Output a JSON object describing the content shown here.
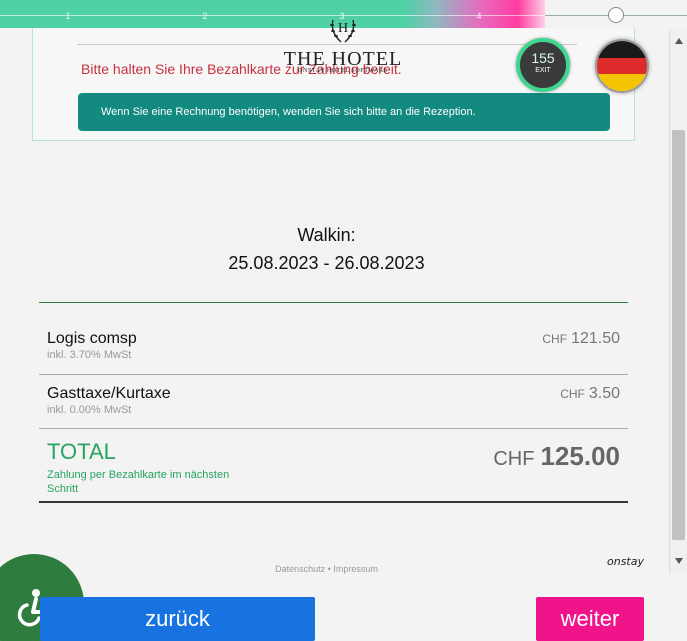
{
  "progress": {
    "steps": [
      "1",
      "2",
      "3",
      "4"
    ],
    "colors": {
      "fill_start": "#4fd1a5",
      "fill_end": "#ff3da0"
    }
  },
  "logo": {
    "crest_letter": "H",
    "title": "THE HOTEL",
    "subtitle": "ONSTAY HOTEL SOFTWARE"
  },
  "timer": {
    "seconds": "155",
    "exit_label": "EXIT"
  },
  "language": {
    "flag_icon": "germany-flag-icon",
    "flag_colors": [
      "#1a1a1a",
      "#dd2b2b",
      "#f4c400"
    ]
  },
  "info": {
    "warning": "Bitte halten Sie Ihre Bezahlkarte zur Zahlung bereit.",
    "notice": "Wenn Sie eine Rechnung benötigen, wenden Sie sich bitte an die Rezeption."
  },
  "booking": {
    "title": "Walkin:",
    "dates": "25.08.2023 - 26.08.2023"
  },
  "invoice": {
    "items": [
      {
        "name": "Logis comsp",
        "tax": "inkl. 3.70% MwSt",
        "currency": "CHF",
        "price": "121.50"
      },
      {
        "name": "Gasttaxe/Kurtaxe",
        "tax": "inkl. 0.00% MwSt",
        "currency": "CHF",
        "price": "3.50"
      }
    ],
    "total": {
      "label": "TOTAL",
      "note": "Zahlung per Bezahlkarte im nächsten Schritt",
      "currency": "CHF",
      "amount": "125.00"
    }
  },
  "footer": {
    "privacy": "Datenschutz",
    "separator": "•",
    "imprint": "Impressum",
    "brand": "onstay"
  },
  "accessibility": {
    "icon": "accessibility-icon"
  },
  "nav": {
    "back": "zurück",
    "next": "weiter"
  }
}
